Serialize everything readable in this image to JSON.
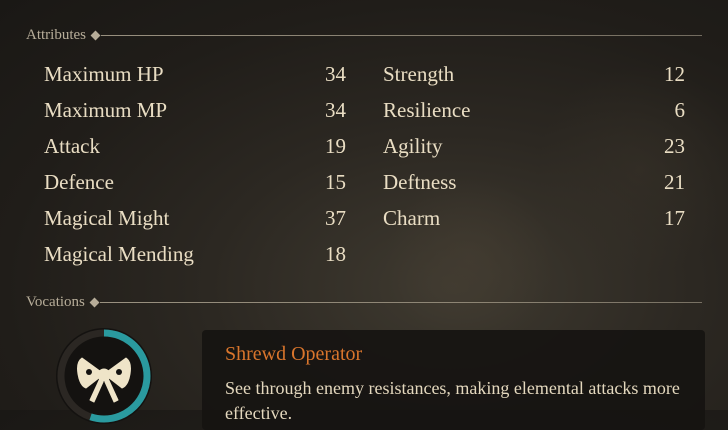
{
  "attributes": {
    "title": "Attributes",
    "left": [
      {
        "label": "Maximum HP",
        "value": "34"
      },
      {
        "label": "Maximum MP",
        "value": "34"
      },
      {
        "label": "Attack",
        "value": "19"
      },
      {
        "label": "Defence",
        "value": "15"
      },
      {
        "label": "Magical Might",
        "value": "37"
      },
      {
        "label": "Magical Mending",
        "value": "18"
      }
    ],
    "right": [
      {
        "label": "Strength",
        "value": "12"
      },
      {
        "label": "Resilience",
        "value": "6"
      },
      {
        "label": "Agility",
        "value": "23"
      },
      {
        "label": "Deftness",
        "value": "21"
      },
      {
        "label": "Charm",
        "value": "17"
      }
    ]
  },
  "vocations": {
    "title": "Vocations",
    "emblem_icon": "bow-ribbon-icon",
    "emblem_progress": 0.55,
    "current": {
      "name": "Shrewd Operator",
      "description": "See through enemy resistances, making elemental attacks more effective."
    }
  },
  "colors": {
    "accent_orange": "#d9752c",
    "ring_teal": "#2a9a9f",
    "text_cream": "#e9ddc3",
    "header_gray": "#b7ad99"
  }
}
